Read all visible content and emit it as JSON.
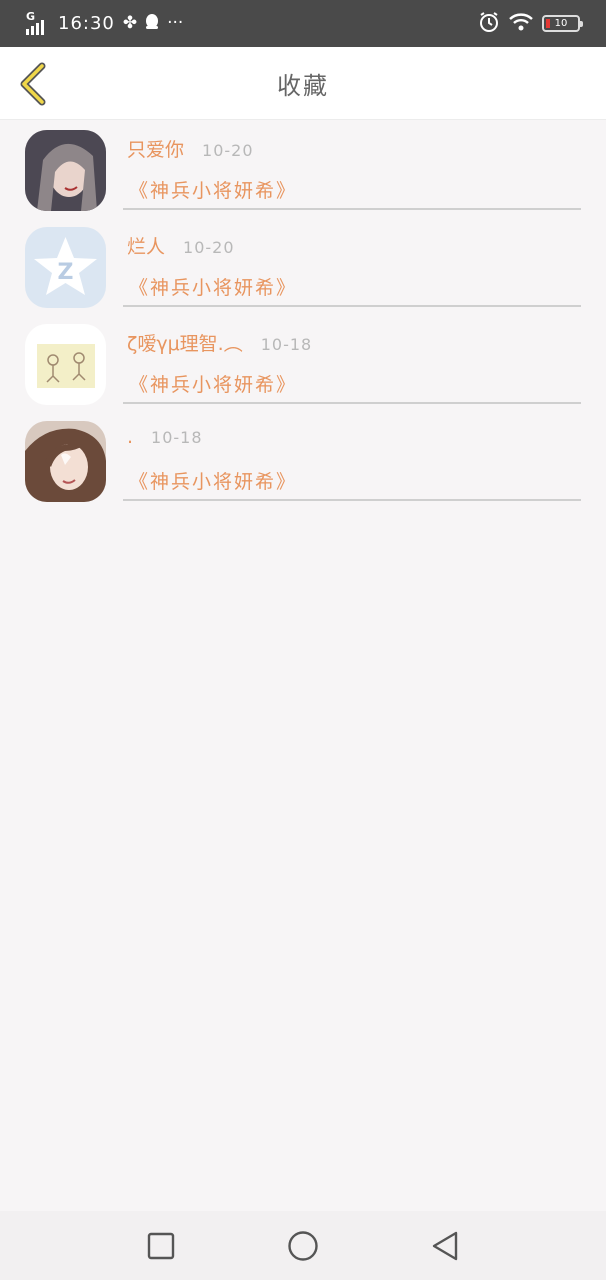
{
  "status_bar": {
    "network": "G",
    "time": "16:30",
    "battery_level": "10",
    "icons": [
      "signal-icon",
      "pinwheel-icon",
      "qq-penguin-icon",
      "more-dots-icon",
      "alarm-icon",
      "wifi-icon",
      "battery-icon"
    ]
  },
  "header": {
    "title": "收藏",
    "back_icon": "chevron-left-icon"
  },
  "favorites": [
    {
      "name": "只爱你",
      "date": "10-20",
      "title": "《神兵小将妍希》"
    },
    {
      "name": "烂人",
      "date": "10-20",
      "title": "《神兵小将妍希》"
    },
    {
      "name": "ζ嗳γμ理智.︵",
      "date": "10-18",
      "title": "《神兵小将妍希》"
    },
    {
      "name": ".",
      "date": "10-18",
      "title": "《神兵小将妍希》"
    }
  ],
  "nav_bar": {
    "buttons": [
      "recents-square-icon",
      "home-circle-icon",
      "back-triangle-icon"
    ]
  },
  "colors": {
    "accent": "#e8955f",
    "back_arrow": "#f0d74a",
    "status_bar": "#4a4a4a",
    "background": "#f7f5f6"
  }
}
